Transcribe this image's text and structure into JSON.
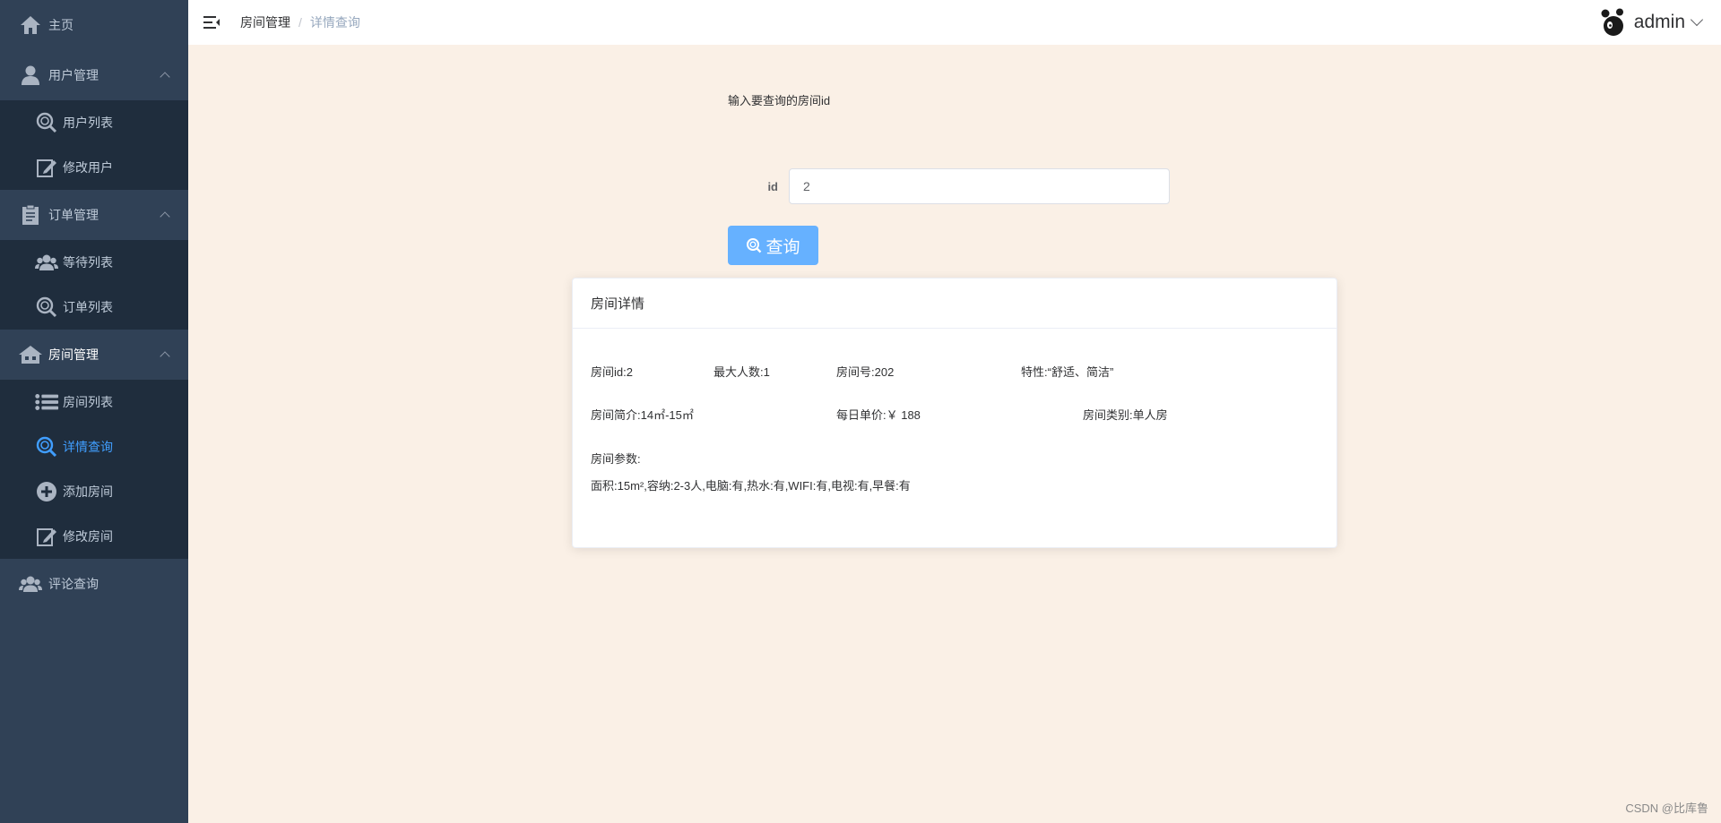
{
  "sidebar": {
    "home": "主页",
    "user_mgmt": "用户管理",
    "user_list": "用户列表",
    "edit_user": "修改用户",
    "order_mgmt": "订单管理",
    "waiting_list": "等待列表",
    "order_list": "订单列表",
    "room_mgmt": "房间管理",
    "room_list": "房间列表",
    "detail_query": "详情查询",
    "add_room": "添加房间",
    "edit_room": "修改房间",
    "comment_query": "评论查询"
  },
  "header": {
    "breadcrumb_first": "房间管理",
    "breadcrumb_sep": "/",
    "breadcrumb_current": "详情查询",
    "username": "admin"
  },
  "query": {
    "prompt": "输入要查询的房间id",
    "id_label": "id",
    "id_value": "2",
    "button_label": "查询"
  },
  "card": {
    "title": "房间详情",
    "room_id": "房间id:2",
    "max_people": "最大人数:1",
    "room_number": "房间号:202",
    "features": "特性:“舒适、简洁”",
    "intro": "房间简介:14㎡-15㎡",
    "daily_price": "每日单价:￥ 188",
    "room_type": "房间类别:单人房",
    "params_label": "房间参数:",
    "params_value": "面积:15m²,容纳:2-3人,电脑:有,热水:有,WIFI:有,电视:有,早餐:有"
  },
  "footer": {
    "watermark": "CSDN @比库鲁"
  },
  "colors": {
    "sidebar_bg": "#304156",
    "submenu_bg": "#1f2d3d",
    "active": "#409eff",
    "main_bg": "#faf0e6",
    "button": "#66b1ff"
  },
  "icons": {
    "home": "home-icon",
    "user": "user-icon",
    "search": "search-icon",
    "edit": "edit-icon",
    "order": "clipboard-icon",
    "group": "group-icon",
    "room": "house-icon",
    "list": "list-icon",
    "add": "add-circle-icon",
    "hamburger": "hamburger-icon",
    "avatar": "avatar-icon",
    "caret": "chevron-down-icon"
  }
}
